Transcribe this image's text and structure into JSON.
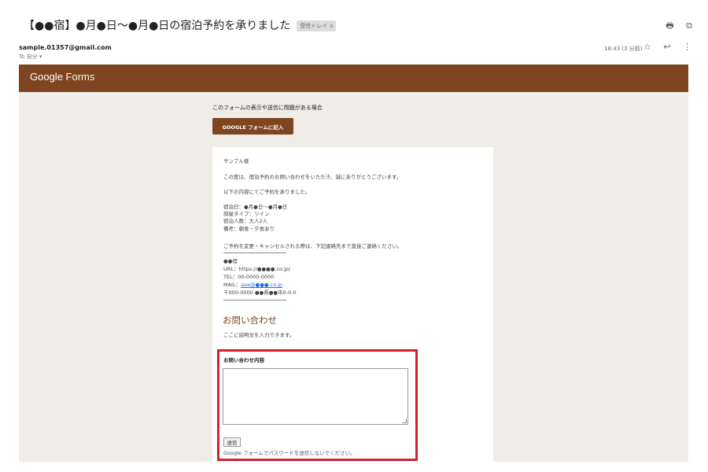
{
  "email": {
    "subject": "【●●宿】●月●日〜●月●日の宿泊予約を承りました",
    "tag": "受信トレイ",
    "tag_close": "x",
    "sender": "sample.01357@gmail.com",
    "to_line": "To 自分 ▾",
    "time": "18:43 (3 分前)"
  },
  "icons": {
    "print": "🖶",
    "open": "⧉",
    "star": "☆",
    "reply": "↩",
    "more": "⋮"
  },
  "forms_header": {
    "logo_google": "Google",
    "logo_forms": " Forms"
  },
  "form": {
    "trouble_text": "このフォームの表示や送信に問題がある場合",
    "fill_button": "GOOGLE フォームに記入",
    "greeting": "サンプル様",
    "thanks": "この度は、宿泊予約のお問い合わせをいただき、誠にありがとうございます。",
    "intro": "以下の内容にてご予約を承りました。",
    "details": {
      "stay": "宿泊日：●月●日〜●月●日",
      "room": "部屋タイプ：ツイン",
      "guests": "宿泊人数：大人2人",
      "notes": "備考：朝食・夕食あり"
    },
    "change_notice": "ご予約を変更・キャンセルされる際は、下記連絡先まで直接ご連絡ください。",
    "contact": {
      "name": "●●宿",
      "url": "URL：https://●●●●.co.jp/",
      "tel": "TEL：00-0000-0000",
      "mail_label": "MAIL：",
      "mail": "aaa@●●●.co.jp",
      "address": "〒000-0000 ●●県●●市0-0-0"
    },
    "inquiry_title": "お問い合わせ",
    "inquiry_desc": "ここに説明文を入力できます。",
    "question_label": "お問い合わせ内容",
    "textarea_value": "",
    "send_button": "送信",
    "password_note": "Google フォームでパスワードを送信しないでください。"
  },
  "colors": {
    "brand_brown": "#7e4520",
    "beige_bg": "#f0ece8",
    "highlight_red": "#d3222a"
  }
}
